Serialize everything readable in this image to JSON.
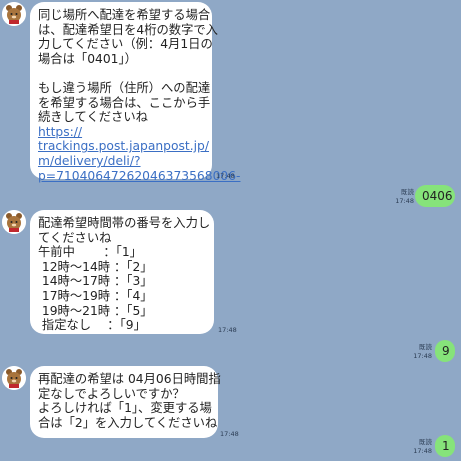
{
  "messages": [
    {
      "lines": [
        "同じ場所へ配達を希望する場合",
        "は、配達希望日を4桁の数字で入",
        "力してください（例：4月1日の",
        "場合は「0401」）",
        "",
        "もし違う場所（住所）への配達",
        "を希望する場合は、ここから手",
        "続きしてくださいね"
      ],
      "link_lines": [
        "https://",
        "trackings.post.japanpost.jp/",
        "m/delivery/deli/?",
        "p=71040647262046373568006-"
      ],
      "time": "17:48"
    },
    {
      "text": "0406",
      "read": "既読",
      "time": "17:48"
    },
    {
      "lines": [
        "配達希望時間帯の番号を入力し",
        "てくださいね",
        "午前中　　 ：「1」",
        " 12時～14時 ：「2」",
        " 14時～17時 ：「3」",
        " 17時～19時 ：「4」",
        " 19時～21時 ：「5」",
        " 指定なし　 ：「9」"
      ],
      "time": "17:48"
    },
    {
      "text": "9",
      "read": "既読",
      "time": "17:48"
    },
    {
      "lines": [
        "再配達の希望は 04月06日時間指",
        "定なしでよろしいですか？",
        "よろしければ「1」、変更する場",
        "合は「2」を入力してくださいね"
      ],
      "time": "17:48"
    },
    {
      "text": "1",
      "read": "既読",
      "time": "17:48"
    }
  ],
  "colors": {
    "background": "#8fa8c6",
    "incoming_bubble": "#ffffff",
    "outgoing_bubble": "#86e37a",
    "link": "#3b6fc4"
  },
  "icons": {
    "bot_avatar": "yu-bin-mascot-icon"
  }
}
